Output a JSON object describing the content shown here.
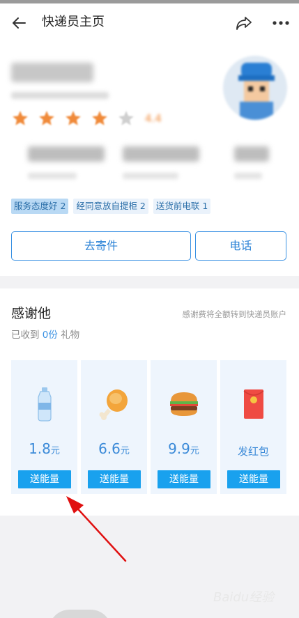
{
  "header": {
    "title": "快递员主页",
    "icons": [
      "back-arrow-icon",
      "share-icon",
      "more-icon"
    ]
  },
  "profile": {
    "rating": "4.4",
    "stars": 4,
    "tags": [
      "服务态度好 2",
      "经同意放自提柜 2",
      "送货前电联 1"
    ],
    "buttons": {
      "send": "去寄件",
      "phone": "电话"
    }
  },
  "thanks": {
    "title": "感谢他",
    "note": "感谢费将全额转到快递员账户",
    "received_prefix": "已收到",
    "received_count": "0份",
    "received_suffix": "礼物",
    "gifts": [
      {
        "icon": "water-bottle-icon",
        "price": "1.8",
        "unit": "元",
        "button": "送能量"
      },
      {
        "icon": "chicken-leg-icon",
        "price": "6.6",
        "unit": "元",
        "button": "送能量"
      },
      {
        "icon": "burger-icon",
        "price": "9.9",
        "unit": "元",
        "button": "送能量"
      },
      {
        "icon": "red-envelope-icon",
        "label": "发红包",
        "button": "送能量"
      }
    ]
  },
  "colors": {
    "accent": "#3b92e3",
    "button": "#19a1ee",
    "star": "#f08a3a",
    "arrow": "#e01010"
  }
}
